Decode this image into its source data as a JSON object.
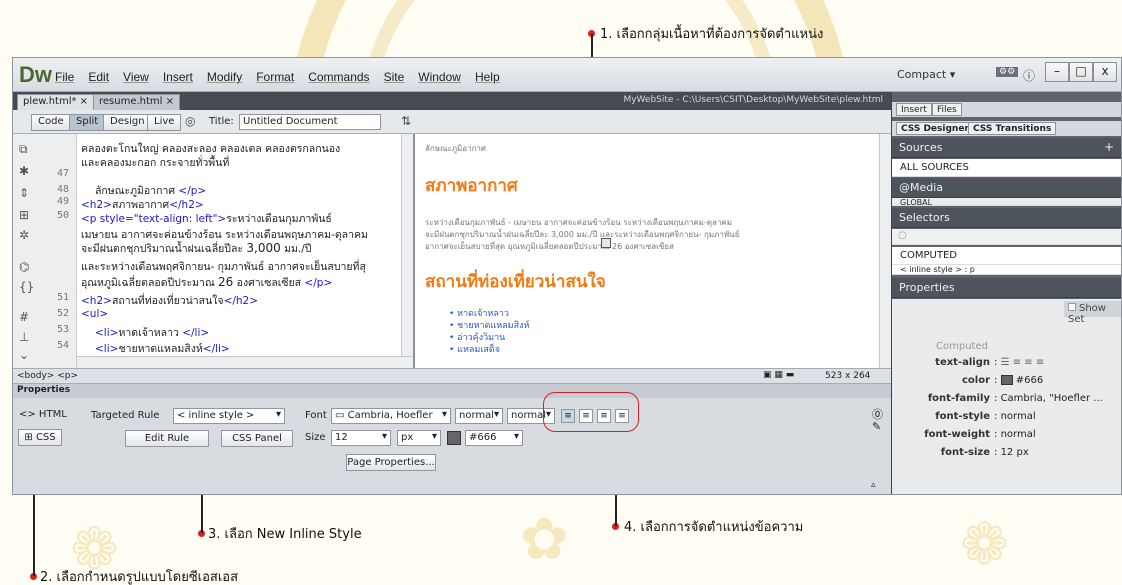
{
  "annotations": {
    "a1": "1. เลือกกลุ่มเนื้อหาที่ต้องการจัดตำแหน่ง",
    "a2": "2. เลือกกำหนดรูปแบบโดยซีเอสเอส",
    "a3": "3. เลือก New Inline Style",
    "a4": "4. เลือกการจัดตำแหน่งข้อความ"
  },
  "app": {
    "logo": "Dw",
    "menus": [
      "File",
      "Edit",
      "View",
      "Insert",
      "Modify",
      "Format",
      "Commands",
      "Site",
      "Window",
      "Help"
    ],
    "workspace": "Compact",
    "window_buttons": {
      "minimize": "–",
      "maximize": "□",
      "close": "x"
    }
  },
  "doc_tabs": [
    {
      "label": "plew.html* ×"
    },
    {
      "label": "resume.html ×"
    }
  ],
  "doc_path": "MyWebSite - C:\\Users\\CSIT\\Desktop\\MyWebSite\\plew.html",
  "toolbar": {
    "code": "Code",
    "split": "Split",
    "design": "Design",
    "live": "Live",
    "title_label": "Title:",
    "title_value": "Untitled Document"
  },
  "code_lines": [
    {
      "num": "",
      "text": "คลองตะโกนใหญ่ คลองสะลอง คลองเตล คลองตรกลกนอง"
    },
    {
      "num": "",
      "text": "และคลองมะกอก กระจายทั่วพื้นที่"
    },
    {
      "num": "47",
      "text": ""
    },
    {
      "num": "48",
      "text": "ลักษณะภูมิอากาศ"
    },
    {
      "num": "49",
      "text": "สภาพอากาศ"
    },
    {
      "num": "50",
      "text": "ระหว่างเดือนกุมภาพันธ์"
    },
    {
      "num": "",
      "text": "เมษายน อากาศจะค่อนข้างร้อน ระหว่างเดือนพฤษภาคม-ตุลาคม"
    },
    {
      "num": "",
      "text": "จะมีฝนตกชุกปริมาณน้ำฝนเฉลี่ยปีละ"
    },
    {
      "num": "",
      "text": "และระหว่างเดือนพฤศจิกายน- กุมภาพันธ์ อากาศจะเย็นสบายที่สุ"
    },
    {
      "num": "",
      "text": "อุณหภูมิเฉลี่ยตลอดปีประมาณ"
    },
    {
      "num": "51",
      "text": "สถานที่ท่องเที่ยวน่าสนใจ"
    },
    {
      "num": "52",
      "text": ""
    },
    {
      "num": "53",
      "text": "หาดเจ้าหลาว"
    },
    {
      "num": "54",
      "text": "ชายหาดแหลมสิงห์"
    }
  ],
  "code_tokens": {
    "p_close": "</p>",
    "h2_open": "<h2>",
    "h2_close": "</h2>",
    "p_open": "<p style=\"text-align: left\">",
    "ul": "<ul>",
    "li_open": "<li>",
    "li_close": "</li>",
    "n3000": "3,000",
    "unit": "มม./ปี",
    "n26": "26",
    "celsius": "องศาเซลเซียส"
  },
  "design": {
    "top_text": "ลักษณะภูมิอากาศ",
    "heading1": "สภาพอากาศ",
    "para1": "ระหว่างเดือนกุมภาพันธ์ - เมษายน อากาศจะค่อนข้างร้อน ระหว่างเดือนพฤษภาคม-ตุลาคม",
    "para2": "จะมีฝนตกชุกปริมาณน้ำฝนเฉลี่ยปีละ 3,000 มม./ปี และระหว่างเดือนพฤศจิกายน- กุมภาพันธ์",
    "para3": "อากาศจะเย็นสบายที่สุด อุณหภูมิเฉลี่ยตลอดปีประมาณ 26 องศาเซลเซียส",
    "heading2": "สถานที่ท่องเที่ยวน่าสนใจ",
    "list": [
      "หาดเจ้าหลาว",
      "ชายหาดแหลมสิงห์",
      "อ่าวคุ้งวิมาน",
      "แหลมเสด็จ"
    ]
  },
  "statusbar": {
    "tags": "<body> <p>",
    "size": "523 x 264"
  },
  "properties": {
    "title": "Properties",
    "html_label": "<> HTML",
    "css_label": "CSS",
    "targeted_rule_label": "Targeted Rule",
    "targeted_rule_value": "< inline style >",
    "edit_rule": "Edit Rule",
    "css_panel": "CSS Panel",
    "font_label": "Font",
    "font_value": "Cambria, Hoefler",
    "style_value": "normal",
    "weight_value": "normal",
    "size_label": "Size",
    "size_value": "12",
    "unit_value": "px",
    "color_value": "#666",
    "page_properties": "Page Properties..."
  },
  "right_panel": {
    "top_tabs": [
      "Insert",
      "Files"
    ],
    "tabs": [
      "CSS Designer",
      "CSS Transitions"
    ],
    "sources": "Sources",
    "all_sources": "ALL SOURCES",
    "media": "@Media",
    "global": "GLOBAL",
    "selectors": "Selectors",
    "computed": "COMPUTED",
    "inline_style": "< inline style > : p",
    "properties": "Properties",
    "show_set": "Show Set",
    "computed_label": "Computed",
    "props": [
      {
        "name": "text-align",
        "value": ""
      },
      {
        "name": "color",
        "value": "#666"
      },
      {
        "name": "font-family",
        "value": "Cambria, \"Hoefler ..."
      },
      {
        "name": "font-style",
        "value": "normal"
      },
      {
        "name": "font-weight",
        "value": "normal"
      },
      {
        "name": "font-size",
        "value": "12 px"
      }
    ]
  },
  "colors": {
    "accent_orange": "#f07a14",
    "annotation_red": "#d42020",
    "link_blue": "#2a58c8"
  }
}
